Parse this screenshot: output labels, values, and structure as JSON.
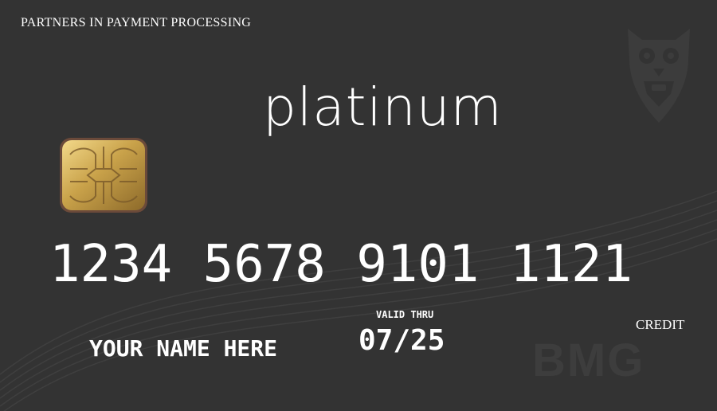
{
  "card": {
    "tagline": "PARTNERS IN PAYMENT PROCESSING",
    "brand": "platinum",
    "number": "1234 5678 9101 1121",
    "valid_thru_label": "VALID THRU",
    "expiry": "07/25",
    "holder_name": "YOUR NAME HERE",
    "card_type": "CREDIT",
    "issuer_logo_text": "BMG"
  },
  "icons": {
    "chip": "emv-chip-icon",
    "mascot": "owl-logo-icon"
  },
  "colors": {
    "card_background": "#333333",
    "text": "#ffffff",
    "chip_gold": "#c9a24a",
    "watermark": "#3d3d3d"
  }
}
